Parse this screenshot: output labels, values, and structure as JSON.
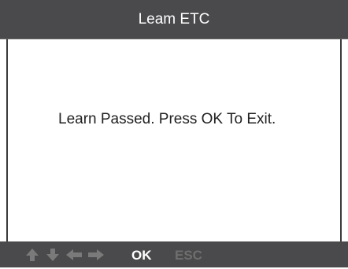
{
  "title": "Leam ETC",
  "message": "Learn Passed. Press OK To Exit.",
  "footer": {
    "nav_icons": [
      "arrow-up-icon",
      "arrow-down-icon",
      "arrow-left-icon",
      "arrow-right-icon"
    ],
    "ok_label": "OK",
    "esc_label": "ESC"
  },
  "colors": {
    "bar": "#4a4a4c",
    "text_light": "#ffffff",
    "disabled": "#6e6e6e"
  }
}
